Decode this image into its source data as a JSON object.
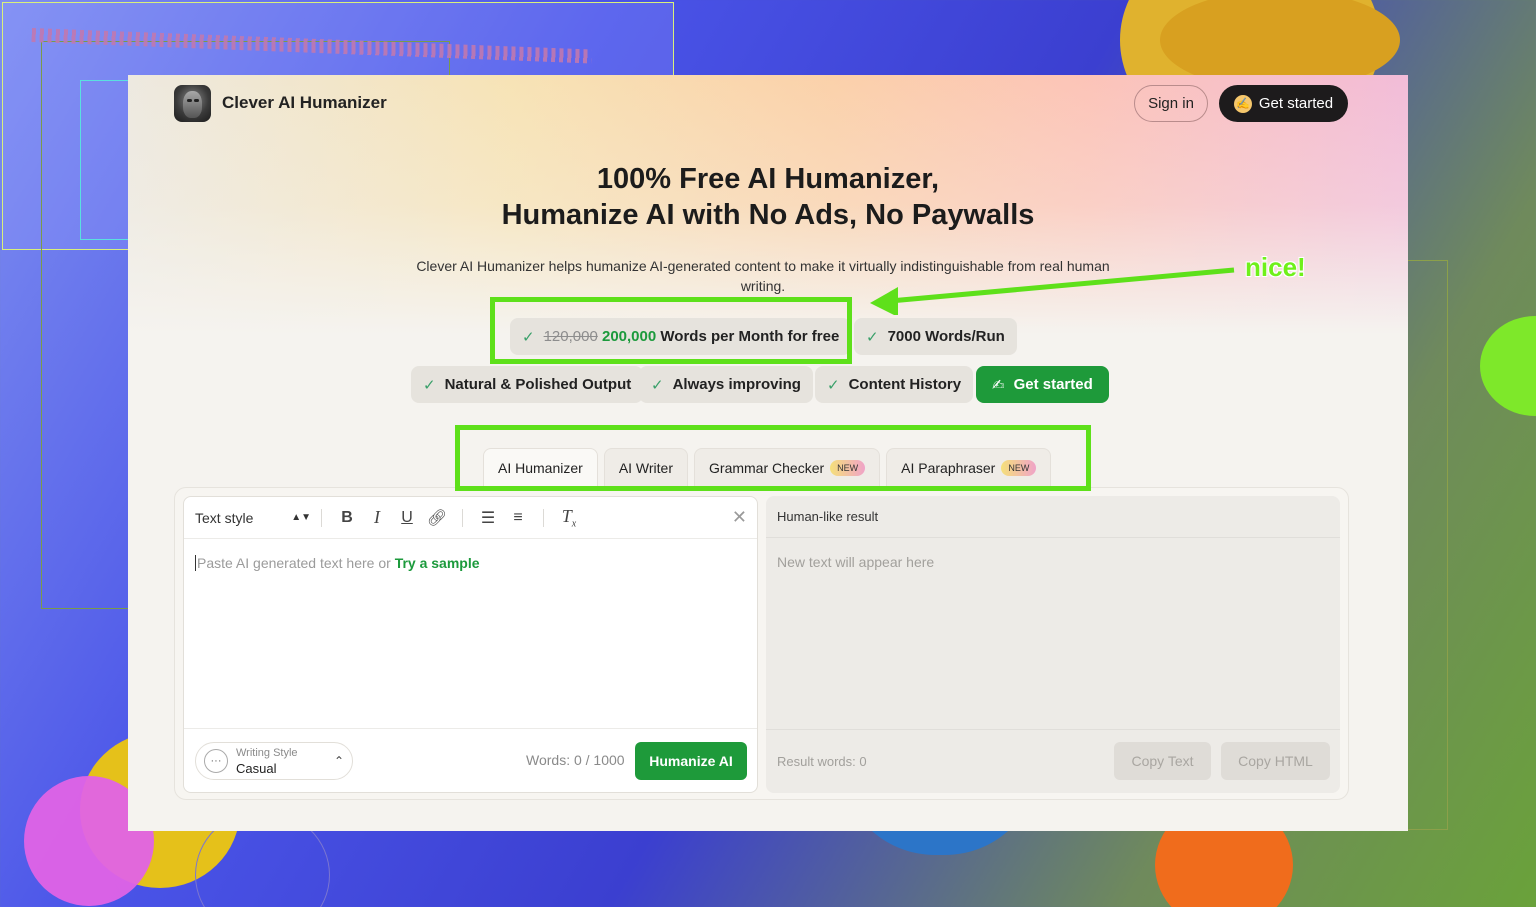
{
  "brand": {
    "name": "Clever AI Humanizer"
  },
  "header": {
    "signin_label": "Sign in",
    "get_started_label": "Get started"
  },
  "hero": {
    "title_line1": "100% Free AI Humanizer,",
    "title_line2": "Humanize AI with No Ads, No Paywalls",
    "subtitle": "Clever AI Humanizer helps humanize AI-generated content to make it virtually indistinguishable from real human writing."
  },
  "features": {
    "words_old": "120,000",
    "words_new": "200,000",
    "words_suffix": "Words per Month for free",
    "words_per_run": "7000 Words/Run",
    "natural": "Natural & Polished Output",
    "improving": "Always improving",
    "history": "Content History",
    "cta": "Get started",
    "cta_icon": "✍"
  },
  "tabs": [
    {
      "label": "AI Humanizer",
      "badge": ""
    },
    {
      "label": "AI Writer",
      "badge": ""
    },
    {
      "label": "Grammar Checker",
      "badge": "NEW"
    },
    {
      "label": "AI Paraphraser",
      "badge": "NEW"
    }
  ],
  "editor": {
    "text_style": "Text style",
    "placeholder_text": "Paste AI generated text here or ",
    "sample_link": "Try a sample",
    "writing_style_label": "Writing Style",
    "writing_style_value": "Casual",
    "word_count": "Words: 0 / 1000",
    "humanize_label": "Humanize AI"
  },
  "result": {
    "header": "Human-like result",
    "placeholder": "New text will appear here",
    "word_count": "Result words: 0",
    "copy_text": "Copy Text",
    "copy_html": "Copy HTML"
  },
  "annotation": {
    "text": "nice!",
    "color": "#5ee01a"
  },
  "colors": {
    "accent_green": "#1e9a3a",
    "dark_button": "#1d1b1c"
  }
}
